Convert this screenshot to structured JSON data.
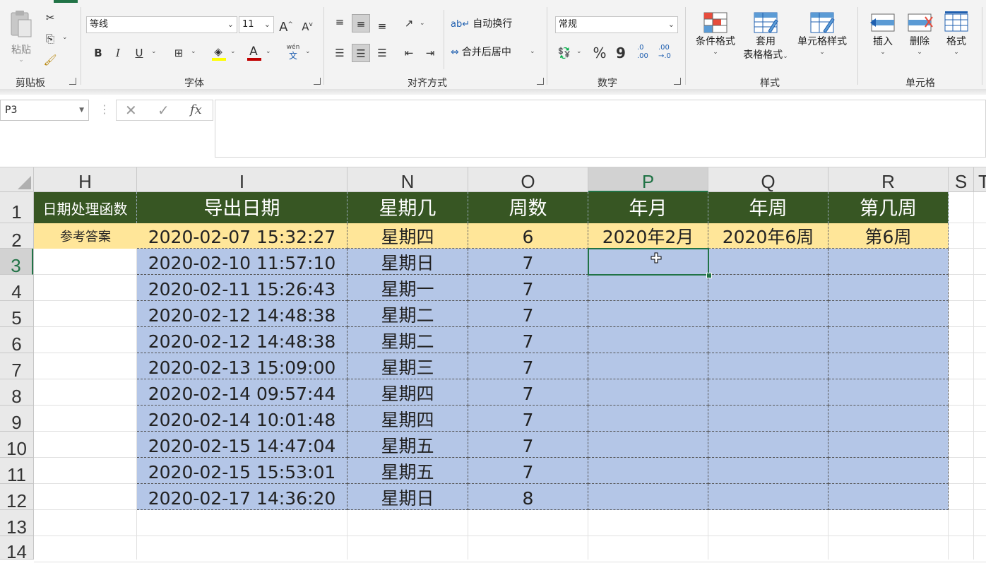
{
  "ribbon": {
    "clipboard": {
      "group_label": "剪贴板",
      "paste_label": "粘贴"
    },
    "font": {
      "group_label": "字体",
      "font_name": "等线",
      "font_size": "11",
      "bold": "B",
      "italic": "I",
      "underline": "U",
      "grow": "A",
      "shrink": "A",
      "phonetic_top": "wén",
      "phonetic_bottom": "文",
      "highlight_color": "#ffff00",
      "font_color": "#c00000"
    },
    "alignment": {
      "group_label": "对齐方式",
      "wrap_text": "自动换行",
      "merge_center": "合并后居中"
    },
    "number": {
      "group_label": "数字",
      "format": "常规",
      "percent": "%",
      "comma": "9",
      "increase_decimal_top": ".0",
      "increase_decimal_bottom": ".00",
      "decrease_decimal_top": ".00",
      "decrease_decimal_bottom": "→.0"
    },
    "styles": {
      "group_label": "样式",
      "conditional_format": "条件格式",
      "format_as_table_1": "套用",
      "format_as_table_2": "表格格式",
      "cell_styles": "单元格样式"
    },
    "cells": {
      "group_label": "单元格",
      "insert": "插入",
      "delete": "删除",
      "format": "格式"
    }
  },
  "formula_bar": {
    "name_box": "P3",
    "cancel": "✕",
    "enter": "✓",
    "fx": "fx",
    "content": ""
  },
  "columns": [
    "H",
    "I",
    "N",
    "O",
    "P",
    "Q",
    "R",
    "S",
    "T"
  ],
  "selected_column": "P",
  "rows": [
    "1",
    "2",
    "3",
    "4",
    "5",
    "6",
    "7",
    "8",
    "9",
    "10",
    "11",
    "12",
    "13",
    "14"
  ],
  "selected_row": "3",
  "sheet": {
    "h1": "日期处理函数",
    "h2": "参考答案",
    "headers": [
      "导出日期",
      "星期几",
      "周数",
      "年月",
      "年周",
      "第几周"
    ],
    "answer_row": [
      "2020-02-07 15:32:27",
      "星期四",
      "6",
      "2020年2月",
      "2020年6周",
      "第6周"
    ],
    "data_rows": [
      [
        "2020-02-10 11:57:10",
        "星期日",
        "7",
        "",
        "",
        ""
      ],
      [
        "2020-02-11 15:26:43",
        "星期一",
        "7",
        "",
        "",
        ""
      ],
      [
        "2020-02-12 14:48:38",
        "星期二",
        "7",
        "",
        "",
        ""
      ],
      [
        "2020-02-12 14:48:38",
        "星期二",
        "7",
        "",
        "",
        ""
      ],
      [
        "2020-02-13 15:09:00",
        "星期三",
        "7",
        "",
        "",
        ""
      ],
      [
        "2020-02-14 09:57:44",
        "星期四",
        "7",
        "",
        "",
        ""
      ],
      [
        "2020-02-14 10:01:48",
        "星期四",
        "7",
        "",
        "",
        ""
      ],
      [
        "2020-02-15 14:47:04",
        "星期五",
        "7",
        "",
        "",
        ""
      ],
      [
        "2020-02-15 15:53:01",
        "星期五",
        "7",
        "",
        "",
        ""
      ],
      [
        "2020-02-17 14:36:20",
        "星期日",
        "8",
        "",
        "",
        ""
      ]
    ]
  },
  "colors": {
    "header_fill": "#375623",
    "answer_fill": "#ffe699",
    "data_fill": "#b4c6e7",
    "selection": "#217346"
  }
}
